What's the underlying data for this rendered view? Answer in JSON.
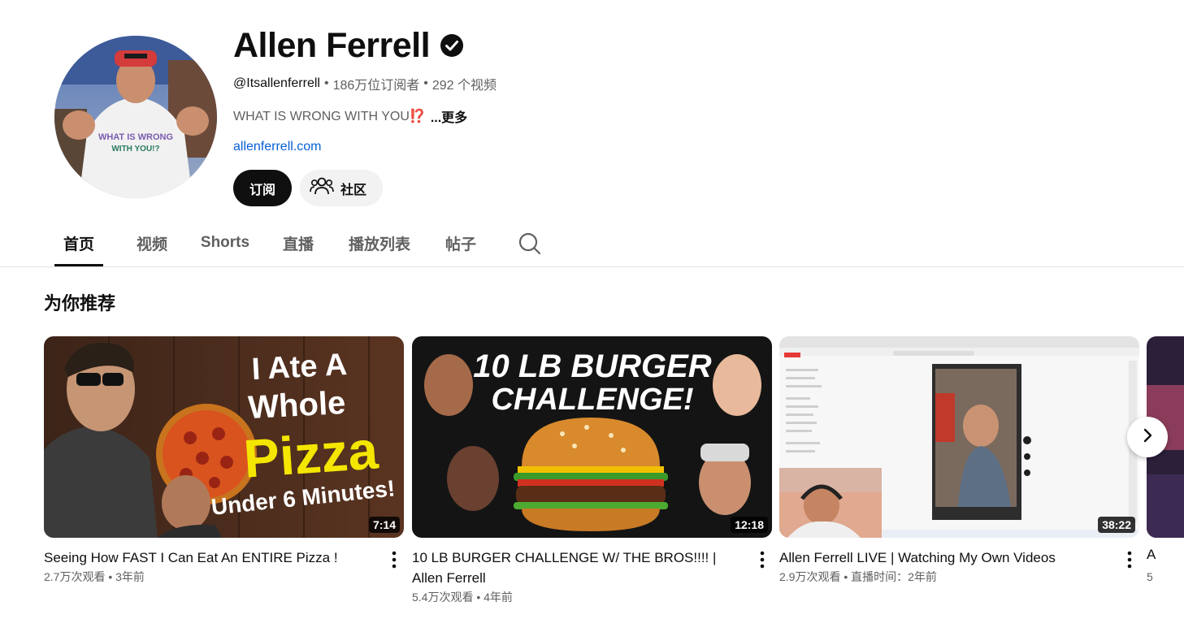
{
  "channel": {
    "name": "Allen Ferrell",
    "handle": "@Itsallenferrell",
    "subscribers": "186万位订阅者",
    "video_count": "292 个视频",
    "sep": "•",
    "description": "WHAT IS WRONG WITH YOU⁉️",
    "more_label": "...更多",
    "link": "allenferrell.com",
    "subscribe_label": "订阅",
    "community_label": "社区",
    "avatar_shirt_text_1": "WHAT IS WRONG",
    "avatar_shirt_text_2": "WITH YOU!?"
  },
  "tabs": [
    {
      "label": "首页",
      "active": true
    },
    {
      "label": "视频",
      "active": false
    },
    {
      "label": "Shorts",
      "active": false
    },
    {
      "label": "直播",
      "active": false
    },
    {
      "label": "播放列表",
      "active": false
    },
    {
      "label": "帖子",
      "active": false
    }
  ],
  "section": {
    "title": "为你推荐"
  },
  "videos": [
    {
      "title": "Seeing How FAST I Can Eat An ENTIRE Pizza !",
      "meta": "2.7万次观看 • 3年前",
      "duration": "7:14",
      "thumb_text": [
        "I Ate A",
        "Whole",
        "Pizza",
        "Under 6 Minutes!"
      ]
    },
    {
      "title": "10 LB BURGER CHALLENGE W/ THE BROS!!!! | Allen Ferrell",
      "meta": "5.4万次观看 • 4年前",
      "duration": "12:18",
      "thumb_text": [
        "10 LB BURGER",
        "CHALLENGE!"
      ]
    },
    {
      "title": "Allen Ferrell LIVE | Watching My Own Videos",
      "meta": "2.9万次观看 • 直播时间：2年前",
      "duration": "38:22"
    }
  ],
  "peek": {
    "title_start": "A",
    "meta_start": "5"
  },
  "colors": {
    "accent_link": "#065fd4",
    "text_primary": "#0f0f0f",
    "text_secondary": "#606060",
    "subscribe_bg": "#0f0f0f",
    "pizza_yellow": "#f5e600"
  },
  "icons": {
    "verified": "verified-check-icon",
    "community": "people-icon",
    "search": "search-icon",
    "more": "kebab-menu-icon",
    "next": "chevron-right-icon"
  }
}
